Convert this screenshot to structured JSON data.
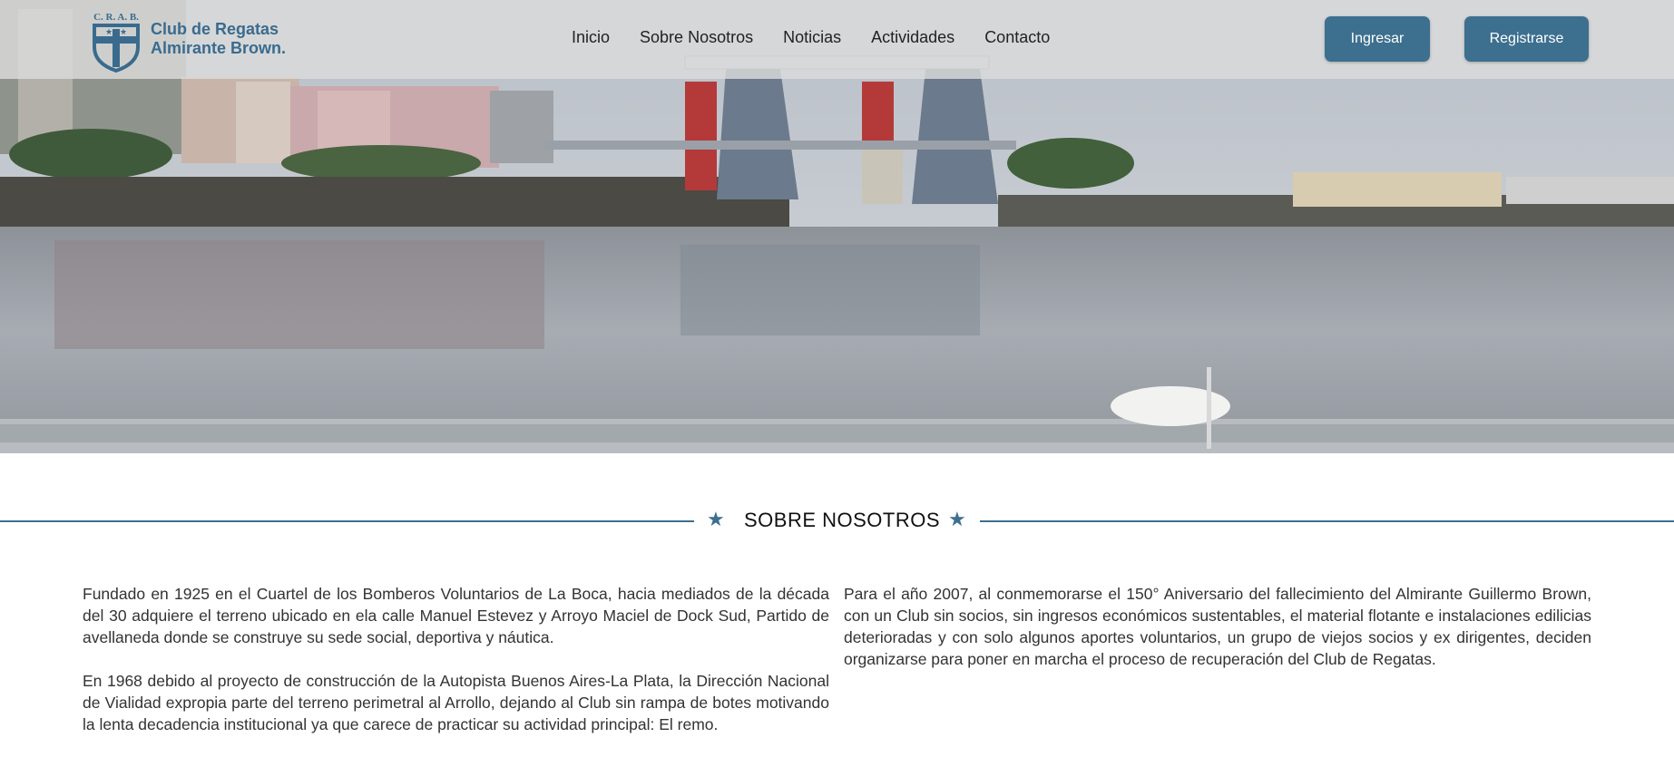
{
  "brand": {
    "crest_initials": "C. R. A. B.",
    "name_line1": "Club de Regatas",
    "name_line2": "Almirante Brown."
  },
  "nav": {
    "items": [
      "Inicio",
      "Sobre Nosotros",
      "Noticias",
      "Actividades",
      "Contacto"
    ]
  },
  "auth": {
    "login_label": "Ingresar",
    "register_label": "Registrarse"
  },
  "section": {
    "title": "SOBRE NOSOTROS"
  },
  "about": {
    "paragraphs": [
      "Fundado en 1925 en el Cuartel de los Bomberos Voluntarios de La Boca, hacia mediados de la década del 30 adquiere el terreno ubicado en ela calle Manuel Estevez y Arroyo Maciel de Dock Sud, Partido de avellaneda donde se construye su sede social, deportiva y náutica.",
      "En 1968 debido al proyecto de construcción de la Autopista Buenos Aires-La Plata, la Dirección Nacional de Vialidad expropia parte del terreno perimetral al Arrollo, dejando al Club sin rampa de botes motivando la lenta decadencia institucional ya que carece de practicar su actividad principal: El remo.",
      "Para el año 2007, al conmemorarse el 150° Aniversario del fallecimiento del Almirante Guillermo Brown, con un Club sin socios, sin ingresos económicos sustentables, el material flotante e instalaciones edilicias deterioradas y con solo algunos aportes voluntarios, un grupo de viejos socios y ex dirigentes, deciden organizarse para poner en marcha el proceso de recuperación del Club de Regatas."
    ]
  },
  "colors": {
    "accent": "#3d6f8f",
    "nav_bg": "#dcdcdc"
  }
}
